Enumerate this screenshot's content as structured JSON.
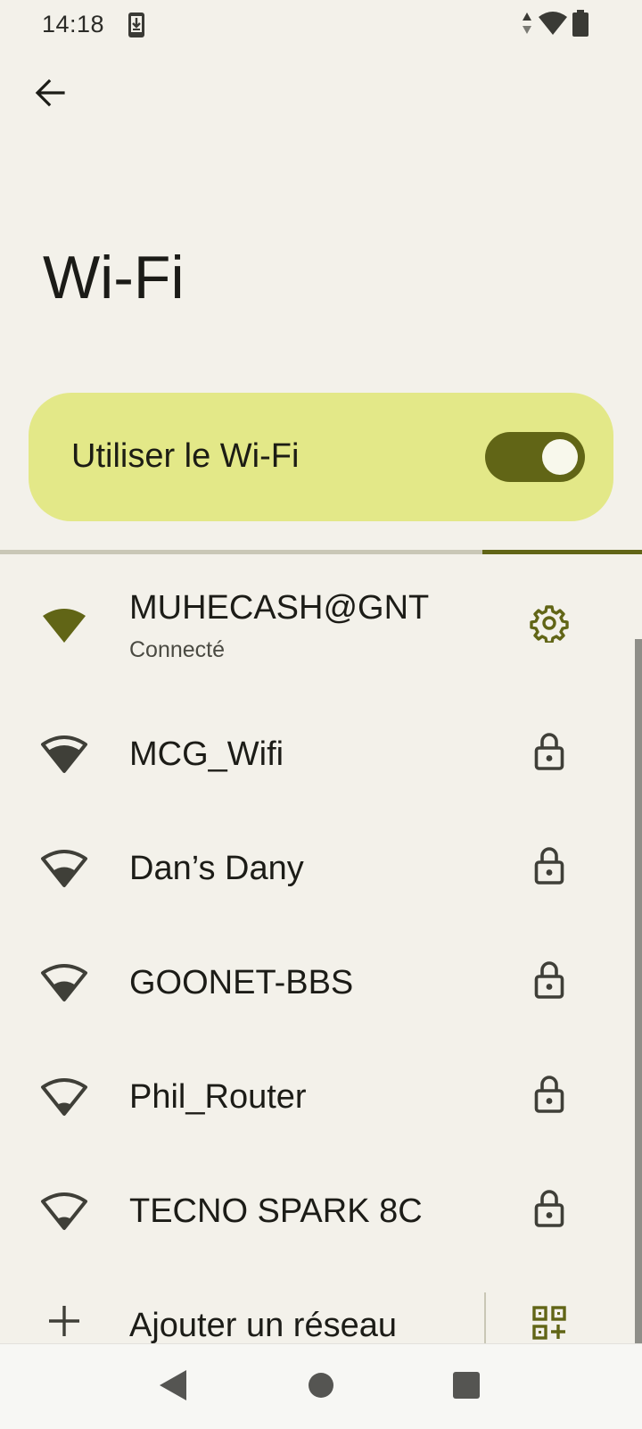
{
  "status_bar": {
    "time": "14:18",
    "icons": [
      "download-notification-icon",
      "data-arrows-icon",
      "wifi-signal-icon",
      "battery-icon"
    ]
  },
  "header": {
    "back_icon": "arrow-back-icon",
    "title": "Wi-Fi"
  },
  "master_switch": {
    "label": "Utiliser le Wi-Fi",
    "enabled": true
  },
  "colors": {
    "accent": "#616516",
    "switch_bg": "#e3e888",
    "background": "#f3f1ea",
    "icon": "#3f3f38"
  },
  "networks": [
    {
      "name": "MUHECASH@GNT",
      "status": "Connecté",
      "signal_level": 4,
      "trailing_icon": "gear-icon"
    },
    {
      "name": "MCG_Wifi",
      "signal_level": 3,
      "trailing_icon": "lock-icon"
    },
    {
      "name": "Dan’s Dany",
      "signal_level": 2,
      "trailing_icon": "lock-icon"
    },
    {
      "name": "GOONET-BBS",
      "signal_level": 2,
      "trailing_icon": "lock-icon"
    },
    {
      "name": "Phil_Router",
      "signal_level": 1,
      "trailing_icon": "lock-icon"
    },
    {
      "name": "TECNO SPARK 8C",
      "signal_level": 1,
      "trailing_icon": "lock-icon"
    }
  ],
  "add_network": {
    "label": "Ajouter un réseau",
    "icon": "plus-icon",
    "scan_icon": "qr-code-scan-icon"
  },
  "nav_bar": {
    "buttons": [
      "back-triangle-icon",
      "home-circle-icon",
      "recents-square-icon"
    ]
  }
}
